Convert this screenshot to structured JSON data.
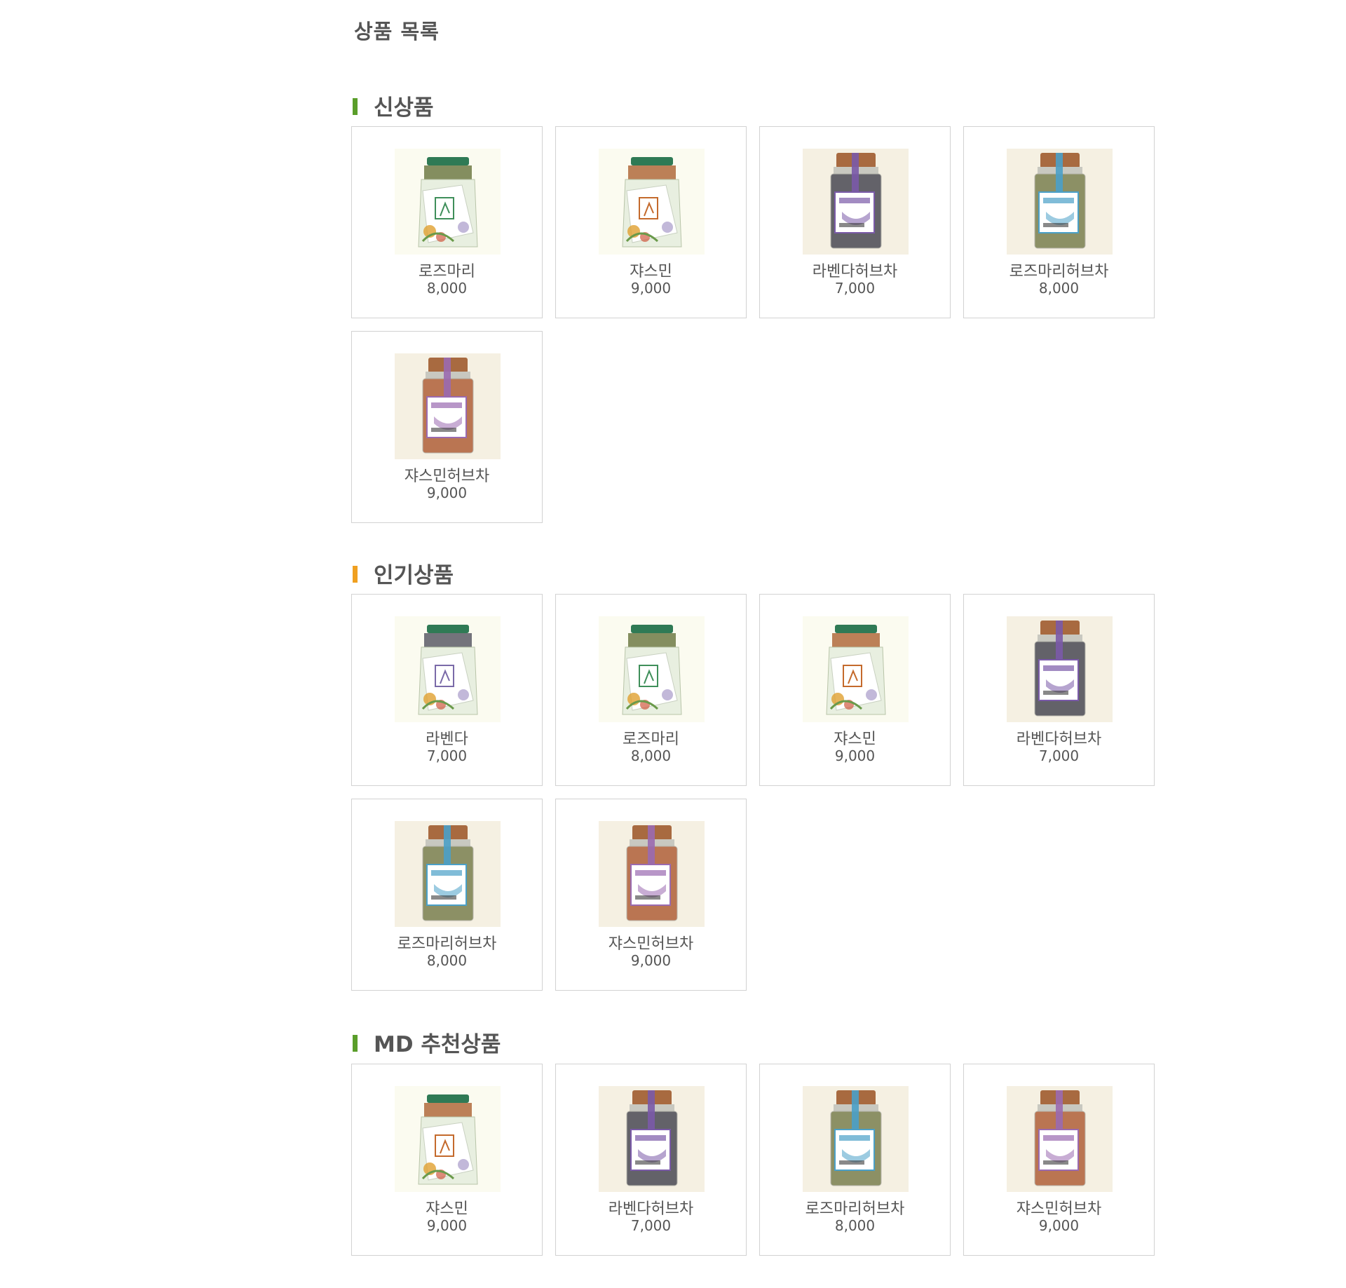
{
  "page": {
    "title": "상품 목록"
  },
  "sections": [
    {
      "key": "new",
      "title": "신상품",
      "bar_color": "#5a9e2a",
      "items": [
        {
          "name": "로즈마리",
          "price": "8,000",
          "style": "box",
          "label_color": "#3f8f5a",
          "content_color": "#6f7a45"
        },
        {
          "name": "쟈스민",
          "price": "9,000",
          "style": "box",
          "label_color": "#c46a2c",
          "content_color": "#b06a3c"
        },
        {
          "name": "라벤다허브차",
          "price": "7,000",
          "style": "jar",
          "label_color": "#7a5aa8",
          "content_color": "#4a4a55"
        },
        {
          "name": "로즈마리허브차",
          "price": "8,000",
          "style": "jar",
          "label_color": "#4aa0c8",
          "content_color": "#7a8050"
        },
        {
          "name": "쟈스민허브차",
          "price": "9,000",
          "style": "jar",
          "label_color": "#9a6ab0",
          "content_color": "#b0603a"
        }
      ]
    },
    {
      "key": "popular",
      "title": "인기상품",
      "bar_color": "#f0a020",
      "items": [
        {
          "name": "라벤다",
          "price": "7,000",
          "style": "box",
          "label_color": "#7a6aa8",
          "content_color": "#5a5a66"
        },
        {
          "name": "로즈마리",
          "price": "8,000",
          "style": "box",
          "label_color": "#3f8f5a",
          "content_color": "#6f7a45"
        },
        {
          "name": "쟈스민",
          "price": "9,000",
          "style": "box",
          "label_color": "#c46a2c",
          "content_color": "#b06a3c"
        },
        {
          "name": "라벤다허브차",
          "price": "7,000",
          "style": "jar",
          "label_color": "#7a5aa8",
          "content_color": "#4a4a55"
        },
        {
          "name": "로즈마리허브차",
          "price": "8,000",
          "style": "jar",
          "label_color": "#4aa0c8",
          "content_color": "#7a8050"
        },
        {
          "name": "쟈스민허브차",
          "price": "9,000",
          "style": "jar",
          "label_color": "#9a6ab0",
          "content_color": "#b0603a"
        }
      ]
    },
    {
      "key": "md",
      "title": "MD 추천상품",
      "bar_color": "#5a9e2a",
      "items": [
        {
          "name": "쟈스민",
          "price": "9,000",
          "style": "box",
          "label_color": "#c46a2c",
          "content_color": "#b06a3c"
        },
        {
          "name": "라벤다허브차",
          "price": "7,000",
          "style": "jar",
          "label_color": "#7a5aa8",
          "content_color": "#4a4a55"
        },
        {
          "name": "로즈마리허브차",
          "price": "8,000",
          "style": "jar",
          "label_color": "#4aa0c8",
          "content_color": "#7a8050"
        },
        {
          "name": "쟈스민허브차",
          "price": "9,000",
          "style": "jar",
          "label_color": "#9a6ab0",
          "content_color": "#b0603a"
        }
      ]
    }
  ]
}
